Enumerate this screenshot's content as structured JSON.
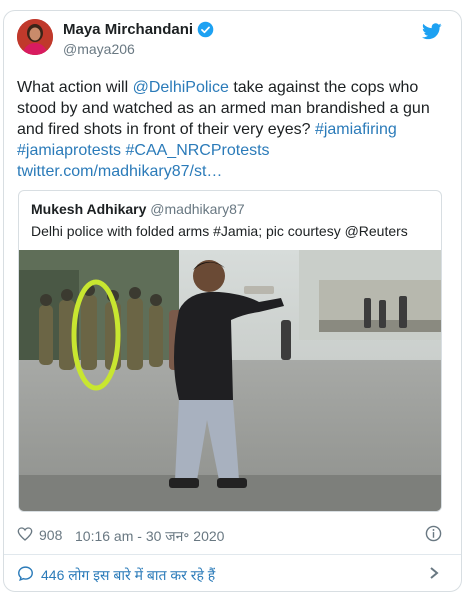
{
  "author": {
    "name": "Maya Mirchandani",
    "handle": "@maya206"
  },
  "tweet": {
    "p1": "What action will ",
    "mention": "@DelhiPolice",
    "p2": " take against the cops who stood by and watched as an armed man brandished a gun and fired shots in front of their very eyes? ",
    "tag1": "#jamiafiring",
    "tag2": "#jamiaprotests",
    "tag3": "#CAA_NRCProtests",
    "link": "twitter.com/madhikary87/st…"
  },
  "quoted": {
    "name": "Mukesh Adhikary",
    "handle": "@madhikary87",
    "text": "Delhi police with folded arms #Jamia; pic courtesy @Reuters"
  },
  "footer": {
    "likes": "908",
    "timestamp": "10:16 am - 30 जन॰ 2020",
    "replies": "446 लोग इस बारे में बात कर रहे हैं"
  },
  "colors": {
    "link": "#2b7bb9",
    "muted": "#697882",
    "verified": "#1da1f2",
    "highlight_circle": "#c8e630"
  }
}
